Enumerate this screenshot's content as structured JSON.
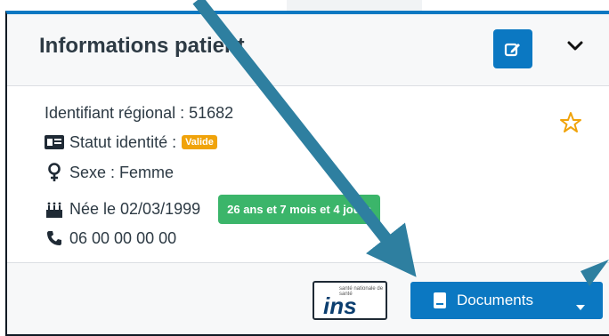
{
  "card": {
    "title": "Informations patient",
    "edit_icon": "edit-icon",
    "collapse_icon": "chevron-down-icon"
  },
  "patient": {
    "regional_id": "Identifiant régional : 51682",
    "identity_status_label": "Statut identité :",
    "identity_status_badge": "Valide",
    "sex": "Sexe : Femme",
    "birth": "Née le 02/03/1999",
    "age_badge": "26 ans et 7 mois et 4 jours",
    "phone": "06 00 00 00 00",
    "favorite_icon": "star-icon"
  },
  "footer": {
    "ins_logo_text": "ins",
    "ins_small_text": "santé nationale de santé",
    "documents_label": "Documents"
  },
  "colors": {
    "primary": "#0b78c2",
    "badge_valid": "#f0a30a",
    "badge_age": "#3bb56a",
    "annotation_arrow": "#2e7fa0"
  }
}
